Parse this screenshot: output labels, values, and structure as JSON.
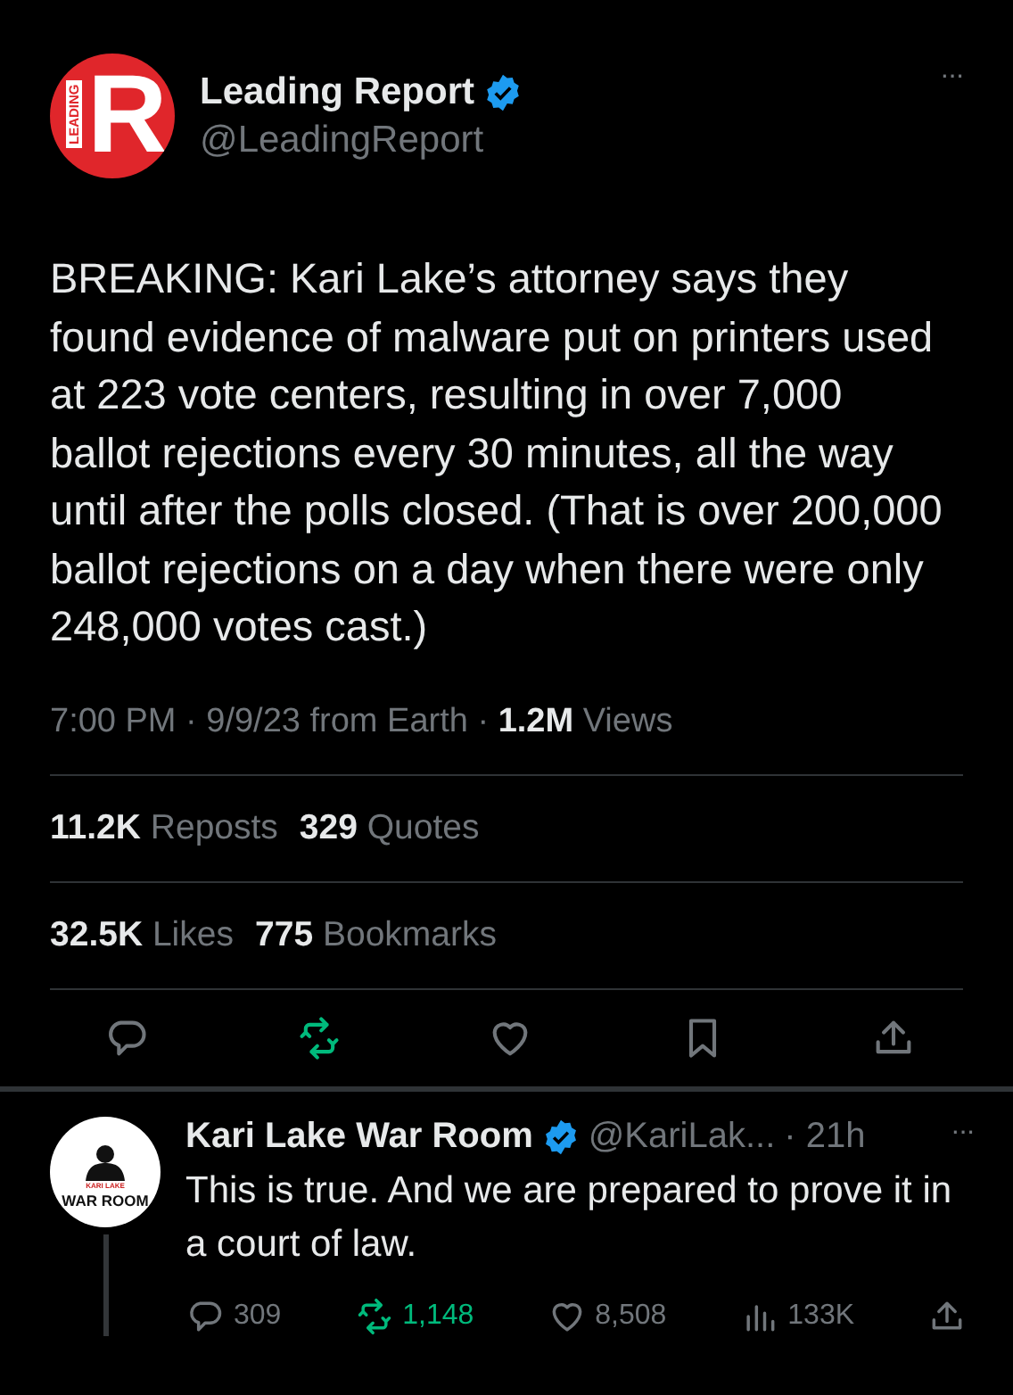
{
  "tweet": {
    "avatar": {
      "side_text": "LEADING",
      "letter": "R"
    },
    "name": "Leading Report",
    "verified": true,
    "handle": "@LeadingReport",
    "more": "···",
    "text": "BREAKING: Kari Lake’s attorney says they found evidence of malware put on printers used at 223 vote centers, resulting in over 7,000 ballot rejections every 30 minutes, all the way until after the polls closed. (That is over 200,000 ballot rejections on a day when there were only 248,000 votes cast.)",
    "meta": "7:00 PM · 9/9/23 from Earth · ",
    "views_count": "1.2M",
    "views_label": "Views",
    "stats": [
      [
        {
          "count": "11.2K",
          "label": "Reposts"
        },
        {
          "count": "329",
          "label": "Quotes"
        }
      ],
      [
        {
          "count": "32.5K",
          "label": "Likes"
        },
        {
          "count": "775",
          "label": "Bookmarks"
        }
      ]
    ],
    "actions": [
      {
        "kind": "reply",
        "active": false
      },
      {
        "kind": "repost",
        "active": true
      },
      {
        "kind": "like",
        "active": false
      },
      {
        "kind": "bookmark",
        "active": false
      },
      {
        "kind": "share",
        "active": false
      }
    ]
  },
  "reply": {
    "avatar": {
      "top_text": "KARI LAKE",
      "text": "WAR ROOM"
    },
    "name": "Kari Lake War Room",
    "verified": true,
    "handle": "@KariLak...",
    "time": "· 21h",
    "more": "···",
    "text": "This is true. And we are prepared to prove it in a court of law.",
    "actions": [
      {
        "kind": "reply",
        "count": "309",
        "active": false
      },
      {
        "kind": "repost",
        "count": "1,148",
        "active": true
      },
      {
        "kind": "like",
        "count": "8,508",
        "active": false
      },
      {
        "kind": "views",
        "count": "133K",
        "active": false
      },
      {
        "kind": "share",
        "active": false
      }
    ]
  }
}
